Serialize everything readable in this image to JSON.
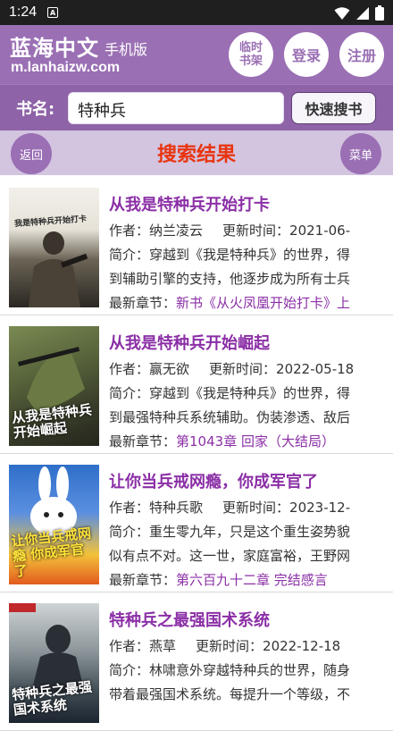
{
  "status_bar": {
    "time": "1:24",
    "a_icon": "A"
  },
  "header": {
    "site_name": "蓝海中文",
    "site_sub": "手机版",
    "site_url": "m.lanhaizw.com",
    "temp_shelf_line1": "临时",
    "temp_shelf_line2": "书架",
    "login": "登录",
    "register": "注册",
    "brand_color": "#9a6fb4"
  },
  "search": {
    "label": "书名:",
    "value": "特种兵",
    "button": "快速搜书"
  },
  "results_bar": {
    "back": "返回",
    "title": "搜索结果",
    "menu": "菜单",
    "title_color": "#e8350f"
  },
  "results": [
    {
      "title": "从我是特种兵开始打卡",
      "author_label": "作者：",
      "author": "纳兰凌云",
      "updated_label": "更新时间：",
      "updated": "2021-06-",
      "intro_label": "简介：",
      "intro_line1": "穿越到《我是特种兵》的世界，得",
      "intro_line2": "到辅助引擎的支持，他逐步成为所有士兵",
      "latest_label": "最新章节：",
      "latest": "新书《从火凤凰开始打卡》上",
      "cover_text": "我是特种兵开始打卡"
    },
    {
      "title": "从我是特种兵开始崛起",
      "author_label": "作者：",
      "author": "赢无欲",
      "updated_label": "更新时间：",
      "updated": "2022-05-18",
      "intro_label": "简介：",
      "intro_line1": "穿越到《我是特种兵》的世界，得",
      "intro_line2": "到最强特种兵系统辅助。伪装渗透、敌后",
      "latest_label": "最新章节：",
      "latest": "第1043章 回家（大结局）",
      "cover_text": "从我是特种兵开始崛起"
    },
    {
      "title": "让你当兵戒网瘾，你成军官了",
      "author_label": "作者：",
      "author": "特种兵歌",
      "updated_label": "更新时间：",
      "updated": "2023-12-",
      "intro_label": "简介：",
      "intro_line1": "重生零九年，只是这个重生姿势貌",
      "intro_line2": "似有点不对。这一世，家庭富裕，王野网",
      "latest_label": "最新章节：",
      "latest": "第六百九十二章 完结感言",
      "cover_text": "让你当兵戒网瘾 你成军官了"
    },
    {
      "title": "特种兵之最强国术系统",
      "author_label": "作者：",
      "author": "燕草",
      "updated_label": "更新时间：",
      "updated": "2022-12-18",
      "intro_label": "简介：",
      "intro_line1": "林啸意外穿越特种兵的世界，随身",
      "intro_line2": "带着最强国术系统。每提升一个等级，不",
      "latest_label": "",
      "latest": "",
      "cover_text": "特种兵之最强国术系统"
    }
  ]
}
